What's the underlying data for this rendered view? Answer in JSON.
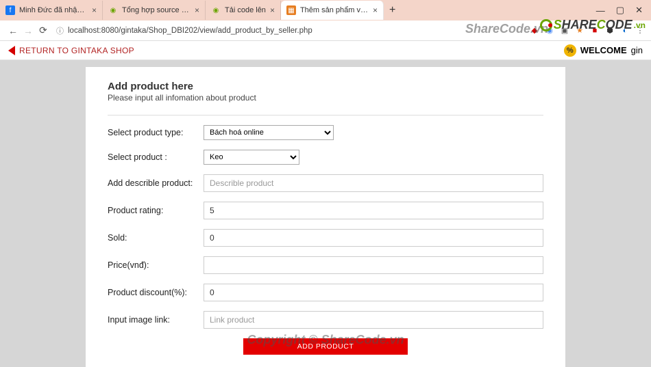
{
  "browser": {
    "tabs": [
      {
        "icon": "fb",
        "title": "Minh Đức đã nhận tin đội bóng"
      },
      {
        "icon": "sc",
        "title": "Tổng hợp source code chất lượn"
      },
      {
        "icon": "sc",
        "title": "Tải code lên"
      },
      {
        "icon": "doc",
        "title": "Thêm sản phẩm vào shop",
        "active": true
      }
    ],
    "url": "localhost:8080/gintaka/Shop_DBI202/view/add_product_by_seller.php"
  },
  "topnav": {
    "return_label": "RETURN TO GINTAKA SHOP",
    "welcome_prefix": "WELCOME",
    "welcome_user": "gin"
  },
  "form": {
    "title": "Add product here",
    "subtitle": "Please input all infomation about product",
    "labels": {
      "type": "Select product type:",
      "product": "Select product :",
      "describe": "Add describle product:",
      "rating": "Product rating:",
      "sold": "Sold:",
      "price": "Price(vnđ):",
      "discount": "Product discount(%):",
      "image": "Input image link:"
    },
    "type_value": "Bách hoá online",
    "product_value": "Keo",
    "describe_placeholder": "Describle product",
    "describe_value": "",
    "rating_value": "5",
    "sold_value": "0",
    "price_value": "",
    "discount_value": "0",
    "image_placeholder": "Link product",
    "image_value": "",
    "submit_label": "ADD PRODUCT"
  },
  "watermark": {
    "text": "ShareCode.vn",
    "logo": "SHARECODE",
    "logo_vn": ".vn",
    "bottom": "Copyright © ShareCode.vn"
  }
}
